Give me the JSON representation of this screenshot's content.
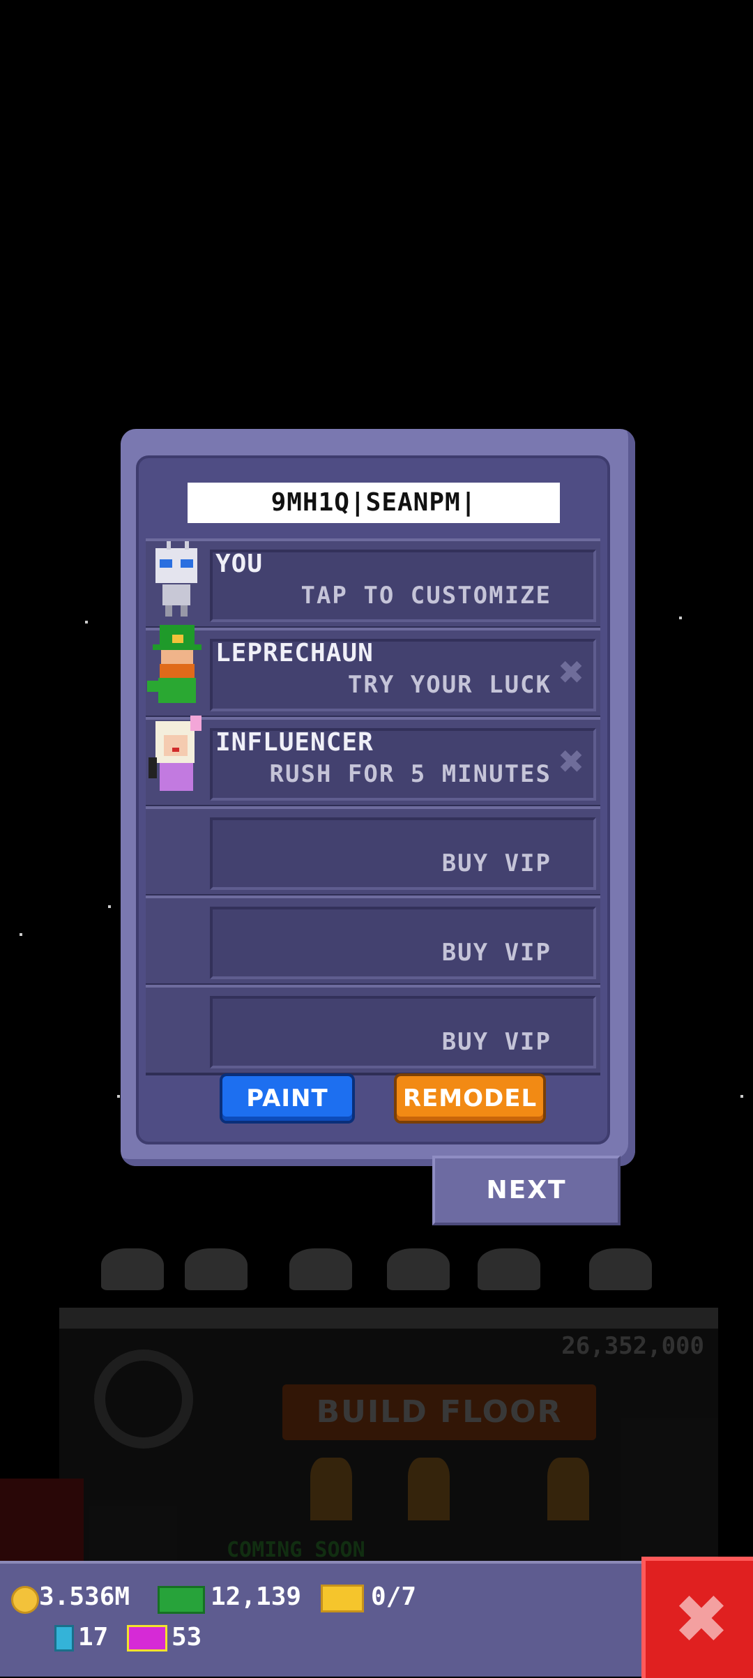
{
  "dialog": {
    "name_value": "9MH1Q|SEANPM|",
    "slots": [
      {
        "title": "YOU",
        "subtitle": "TAP TO CUSTOMIZE",
        "avatar_icon": "robot-avatar-icon",
        "removable": false
      },
      {
        "title": "LEPRECHAUN",
        "subtitle": "TRY YOUR LUCK",
        "avatar_icon": "leprechaun-avatar-icon",
        "removable": true
      },
      {
        "title": "INFLUENCER",
        "subtitle": "RUSH FOR 5 MINUTES",
        "avatar_icon": "influencer-avatar-icon",
        "removable": true
      },
      {
        "title": "",
        "subtitle": "BUY VIP",
        "removable": false
      },
      {
        "title": "",
        "subtitle": "BUY VIP",
        "removable": false
      },
      {
        "title": "",
        "subtitle": "BUY VIP",
        "removable": false
      }
    ],
    "paint_label": "PAINT",
    "remodel_label": "REMODEL"
  },
  "next_label": "NEXT",
  "background_scene": {
    "build_button_label": "BUILD FLOOR",
    "floor_cost": "26,352,000",
    "coming_soon": "COMING SOON"
  },
  "status_bar": {
    "coins": "3.536M",
    "bux": "12,139",
    "tickets": "0/7",
    "tower_bux": "17",
    "vip_tickets": "53"
  },
  "colors": {
    "dialog_frame": "#7a78b0",
    "dialog_inner": "#4f4d84",
    "paint": "#1d6ff0",
    "remodel": "#f28a14",
    "close": "#e02020"
  }
}
